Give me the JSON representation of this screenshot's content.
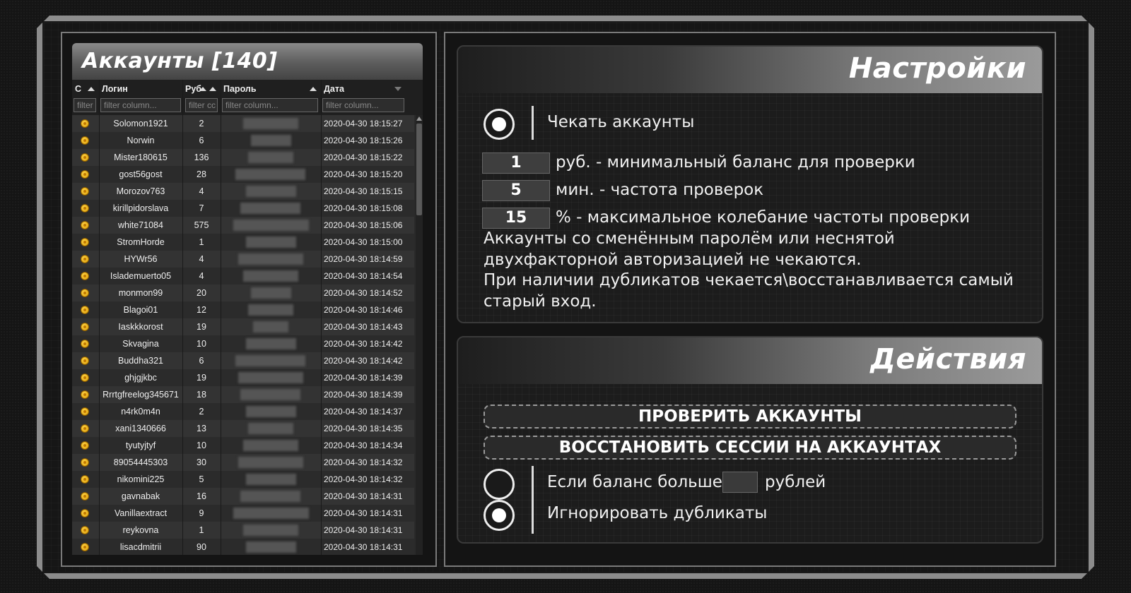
{
  "accounts": {
    "title": "Аккаунты [140]",
    "columns": [
      {
        "label": "С",
        "filter": "filter"
      },
      {
        "label": "Логин",
        "filter": "filter column..."
      },
      {
        "label": "Руб",
        "filter": "filter cc"
      },
      {
        "label": "Пароль",
        "filter": "filter column..."
      },
      {
        "label": "Дата",
        "filter": "filter column..."
      }
    ],
    "rows": [
      {
        "login": "Solomon1921",
        "rub": "2",
        "date": "2020-04-30 18:15:27"
      },
      {
        "login": "Norwin",
        "rub": "6",
        "date": "2020-04-30 18:15:26"
      },
      {
        "login": "Mister180615",
        "rub": "136",
        "date": "2020-04-30 18:15:22"
      },
      {
        "login": "gost56gost",
        "rub": "28",
        "date": "2020-04-30 18:15:20"
      },
      {
        "login": "Morozov763",
        "rub": "4",
        "date": "2020-04-30 18:15:15"
      },
      {
        "login": "kirillpidorslava",
        "rub": "7",
        "date": "2020-04-30 18:15:08"
      },
      {
        "login": "white71084",
        "rub": "575",
        "date": "2020-04-30 18:15:06"
      },
      {
        "login": "StromHorde",
        "rub": "1",
        "date": "2020-04-30 18:15:00"
      },
      {
        "login": "HYWr56",
        "rub": "4",
        "date": "2020-04-30 18:14:59"
      },
      {
        "login": "Islademuerto05",
        "rub": "4",
        "date": "2020-04-30 18:14:54"
      },
      {
        "login": "monmon99",
        "rub": "20",
        "date": "2020-04-30 18:14:52"
      },
      {
        "login": "Blagoi01",
        "rub": "12",
        "date": "2020-04-30 18:14:46"
      },
      {
        "login": "Iaskkkorost",
        "rub": "19",
        "date": "2020-04-30 18:14:43"
      },
      {
        "login": "Skvagina",
        "rub": "10",
        "date": "2020-04-30 18:14:42"
      },
      {
        "login": "Buddha321",
        "rub": "6",
        "date": "2020-04-30 18:14:42"
      },
      {
        "login": "ghjgjkbc",
        "rub": "19",
        "date": "2020-04-30 18:14:39"
      },
      {
        "login": "Rrrtgfreelog345671",
        "rub": "18",
        "date": "2020-04-30 18:14:39"
      },
      {
        "login": "n4rk0m4n",
        "rub": "2",
        "date": "2020-04-30 18:14:37"
      },
      {
        "login": "xani1340666",
        "rub": "13",
        "date": "2020-04-30 18:14:35"
      },
      {
        "login": "tyutyjtyf",
        "rub": "10",
        "date": "2020-04-30 18:14:34"
      },
      {
        "login": "89054445303",
        "rub": "30",
        "date": "2020-04-30 18:14:32"
      },
      {
        "login": "nikomini225",
        "rub": "5",
        "date": "2020-04-30 18:14:32"
      },
      {
        "login": "gavnabak",
        "rub": "16",
        "date": "2020-04-30 18:14:31"
      },
      {
        "login": "Vanillaextract",
        "rub": "9",
        "date": "2020-04-30 18:14:31"
      },
      {
        "login": "reykovna",
        "rub": "1",
        "date": "2020-04-30 18:14:31"
      },
      {
        "login": "lisacdmitrii",
        "rub": "90",
        "date": "2020-04-30 18:14:31"
      }
    ],
    "status_icon": "coin-icon"
  },
  "settings": {
    "title": "Настройки",
    "check_accounts_label": "Чекать аккаунты",
    "check_accounts_on": true,
    "min_balance_value": "1",
    "min_balance_label": "руб. - минимальный баланс для проверки",
    "frequency_value": "5",
    "frequency_label": "мин. - частота проверок",
    "variation_value": "15",
    "variation_label": "% - максимальное колебание частоты проверки",
    "note_line1": "Аккаунты со сменённым паролём или неснятой",
    "note_line2": "двухфакторной авторизацией не чекаются.",
    "note_line3": "При наличии дубликатов чекается\\восстанавливается самый",
    "note_line4": "старый вход."
  },
  "actions": {
    "title": "Действия",
    "check_button": "ПРОВЕРИТЬ АККАУНТЫ",
    "restore_button": "ВОССТАНОВИТЬ СЕССИИ НА АККАУНТАХ",
    "balance_cond_prefix": "Если баланс больше",
    "balance_cond_suffix": "рублей",
    "balance_cond_on": false,
    "balance_cond_value": "",
    "ignore_dupes_label": "Игнорировать дубликаты",
    "ignore_dupes_on": true
  }
}
